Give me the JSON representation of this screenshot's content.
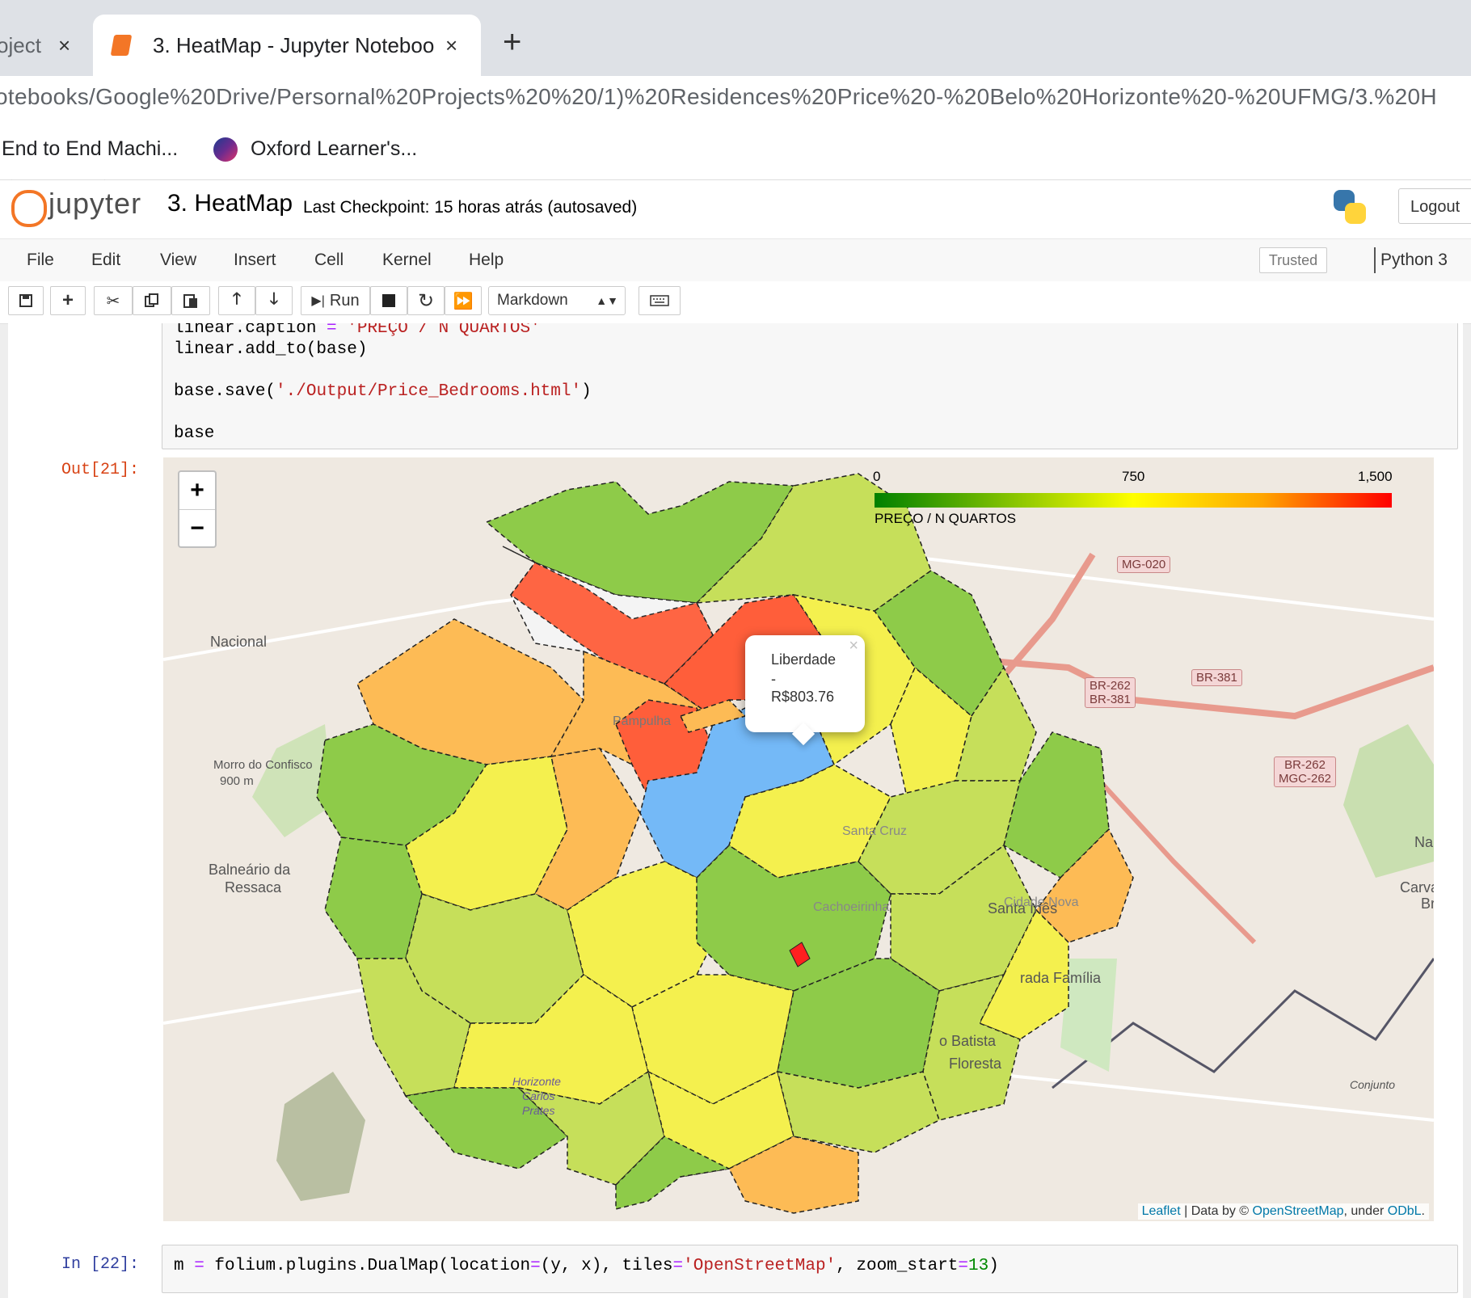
{
  "browser": {
    "tabs": [
      {
        "title": "oject",
        "active": false
      },
      {
        "title": "3. HeatMap - Jupyter Noteboo",
        "active": true
      }
    ],
    "new_tab_label": "+",
    "close_label": "×",
    "url": "otebooks/Google%20Drive/Persornal%20Projects%20%20/1)%20Residences%20Price%20-%20Belo%20Horizonte%20-%20UFMG/3.%20H",
    "bookmarks": [
      "End to End Machi...",
      "Oxford Learner's..."
    ]
  },
  "jupyter": {
    "logo_text": "jupyter",
    "notebook_name": "3. HeatMap",
    "checkpoint": "Last Checkpoint: 15 horas atrás  (autosaved)",
    "logout_label": "Logout",
    "menu": [
      "File",
      "Edit",
      "View",
      "Insert",
      "Cell",
      "Kernel",
      "Help"
    ],
    "trusted_label": "Trusted",
    "kernel_name": "Python 3",
    "toolbar": {
      "run_label": "Run",
      "cell_type": "Markdown"
    }
  },
  "cells": {
    "prev_code": {
      "line1_a": "linear.caption ",
      "line1_op": "=",
      "line1_str": "'PREÇO / N QUARTOS'",
      "line2": "linear.add_to(base)",
      "line3_a": "base.save(",
      "line3_str": "'./Output/Price_Bedrooms.html'",
      "line3_b": ")",
      "line4": "base"
    },
    "out_prompt": "Out[21]:",
    "in_prompt": "In [22]:",
    "next_code": {
      "a": "m ",
      "op1": "=",
      "b": " folium.plugins.DualMap(location",
      "op2": "=",
      "c": "(y, x), tiles",
      "op3": "=",
      "str": "'OpenStreetMap'",
      "d": ", zoom_start",
      "op4": "=",
      "num": "13",
      "e": ")"
    }
  },
  "map": {
    "zoom_in": "+",
    "zoom_out": "−",
    "legend": {
      "ticks": [
        "0",
        "750",
        "1,500"
      ],
      "caption": "PREÇO / N QUARTOS",
      "colors": [
        "#008000",
        "#ffff00",
        "#ff0000"
      ],
      "range": [
        0,
        1500
      ]
    },
    "popup": {
      "name": "Liberdade",
      "sep": "-",
      "value": "R$803.76",
      "close": "×"
    },
    "place_labels": [
      "Nacional",
      "Morro do Confisco",
      "900 m",
      "Balneário da",
      "Ressaca",
      "Santa Inês",
      "Carvall",
      "Bri",
      "Na",
      "rada Família",
      "o Batista",
      "Floresta",
      "Conjunto",
      "Pampulha",
      "Santa Cruz",
      "Cachoeirinha",
      "Cidade Nova",
      "Horizonte",
      "Carlos",
      "Prates"
    ],
    "shields": [
      "MG-020",
      "BR-262",
      "BR-381",
      "BR-381",
      "BR-262",
      "MGC-262"
    ],
    "attribution": {
      "leaflet": "Leaflet",
      "sep": " | Data by © ",
      "osm": "OpenStreetMap",
      "under": ", under ",
      "odbl": "ODbL",
      "end": "."
    },
    "region_colors": {
      "highlight": "#74b9f7",
      "red": "#ff5e3a",
      "orange": "#fdbb55",
      "yellow": "#f4f04e",
      "light_green": "#c6df5a",
      "green": "#8ecb49",
      "nodata": "#f2f2f2"
    }
  }
}
